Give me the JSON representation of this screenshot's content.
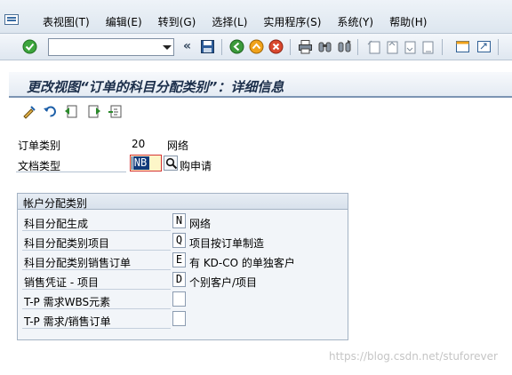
{
  "menu": {
    "items": [
      "表视图(T)",
      "编辑(E)",
      "转到(G)",
      "选择(L)",
      "实用程序(S)",
      "系统(Y)",
      "帮助(H)"
    ]
  },
  "toolbar": {
    "command_field_value": ""
  },
  "title": "更改视图“订单的科目分配类别”：详细信息",
  "fields": {
    "order_category_label": "订单类别",
    "order_category_value": "20",
    "order_category_desc": "网络",
    "doc_type_label": "文档类型",
    "doc_type_value": "NB",
    "doc_type_desc": "购申请"
  },
  "group": {
    "title": "帐户分配类别",
    "rows": [
      {
        "label": "科目分配生成",
        "value": "N",
        "desc": "网络"
      },
      {
        "label": "科目分配类别项目",
        "value": "Q",
        "desc": "项目按订单制造"
      },
      {
        "label": "科目分配类别销售订单",
        "value": "E",
        "desc": "有 KD-CO 的单独客户"
      },
      {
        "label": "销售凭证 - 项目",
        "value": "D",
        "desc": "个别客户/项目"
      },
      {
        "label": "T-P 需求WBS元素",
        "value": "",
        "desc": ""
      },
      {
        "label": "T-P 需求/销售订单",
        "value": "",
        "desc": ""
      }
    ]
  },
  "watermark": "https://blog.csdn.net/stuforever"
}
